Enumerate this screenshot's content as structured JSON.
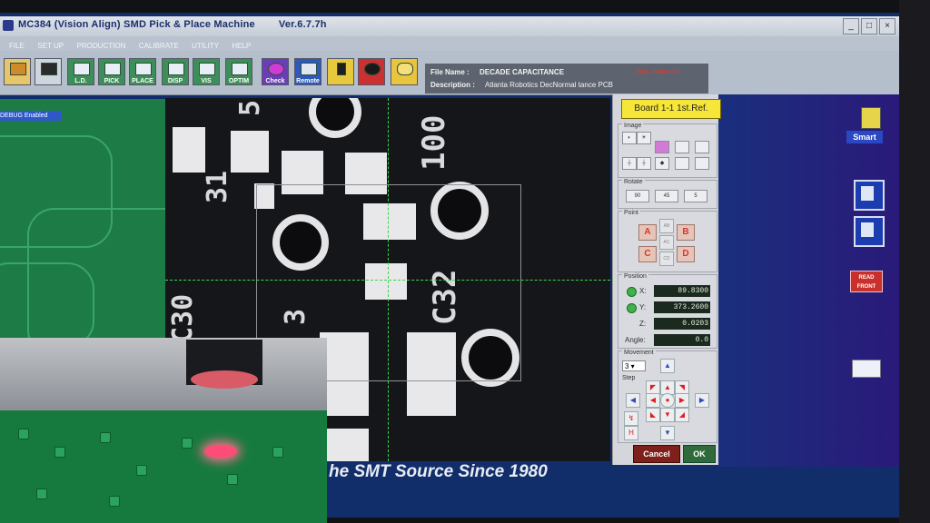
{
  "window": {
    "title": "MC384 (Vision Align) SMD Pick & Place Machine",
    "version": "Ver.6.7.7h"
  },
  "menu": [
    "FILE",
    "SET UP",
    "PRODUCTION",
    "CALIBRATE",
    "UTILITY",
    "HELP"
  ],
  "toolbar": {
    "buttons": [
      "L.D.",
      "PICK",
      "PLACE",
      "DISP",
      "VIS",
      "OPTIM"
    ],
    "special": [
      "Check ID",
      "Remote"
    ]
  },
  "fileinfo": {
    "file_label": "File Name :",
    "file_value": "DECADE CAPACITANCE",
    "desc_label": "Description :",
    "desc_value": "Atlanta Robotics DecNormal    tance PCB",
    "red_text": "Disp. Status V2"
  },
  "debug": "DEBUG Enabled",
  "camera": {
    "silk": [
      "100",
      "C32",
      "C30",
      "31",
      "5",
      "3"
    ]
  },
  "panel": {
    "board_ref": "Board 1-1 1st.Ref.",
    "image_label": "Image",
    "rotate_label": "Rotate",
    "rotate_buttons": [
      "90",
      "45",
      "5"
    ],
    "point_label": "Point",
    "point_buttons": [
      "A",
      "B",
      "C",
      "D"
    ],
    "point_mid": [
      "AB",
      "AC",
      "CD"
    ],
    "position_label": "Position",
    "x_label": "X:",
    "x": "89.8300",
    "y_label": "Y:",
    "y": "373.2600",
    "z_label": "Z:",
    "z": "0.0203",
    "angle_label": "Angle:",
    "angle": "0.0",
    "movement_label": "Movement",
    "step_label": "Step",
    "step_value": "3",
    "cancel": "Cancel",
    "ok": "OK"
  },
  "right": {
    "smart": "Smart",
    "read_front": "READ FRONT"
  },
  "slogan": "he SMT Source Since 1980",
  "colors": {
    "accent": "#3dd24a",
    "yellow": "#f7e63a",
    "red": "#c9302c"
  }
}
